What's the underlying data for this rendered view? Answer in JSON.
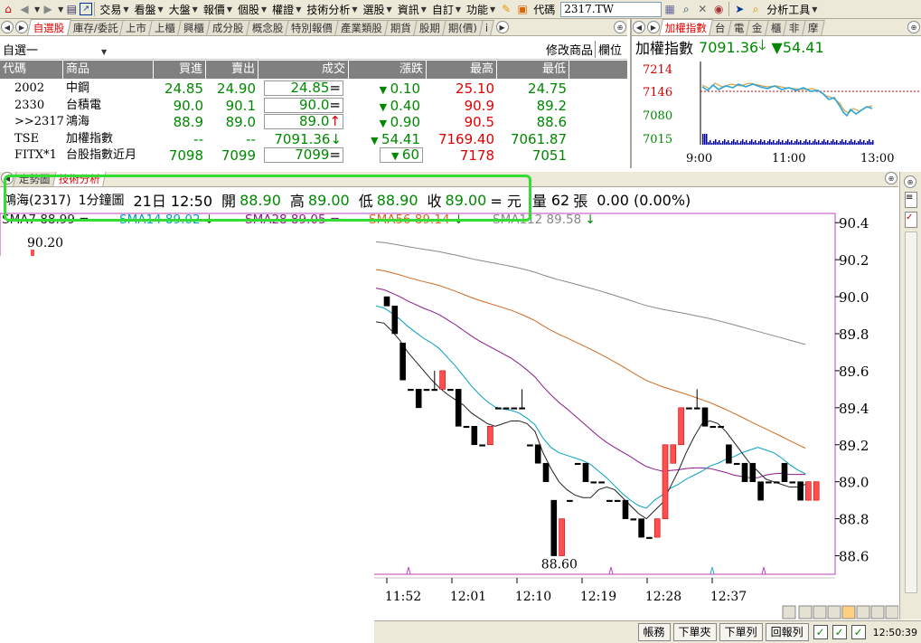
{
  "toolbar": {
    "items": [
      "交易",
      "看盤",
      "大盤",
      "報價",
      "個股",
      "權證",
      "技術分析",
      "選股",
      "資訊",
      "自訂",
      "功能"
    ],
    "code_label": "代碼",
    "code_value": "2317.TW",
    "analysis_tools": "分析工具"
  },
  "top_tabs": [
    "自選股",
    "庫存/委託",
    "上市",
    "上櫃",
    "興櫃",
    "成分股",
    "概念股",
    "特別報價",
    "產業類股",
    "期貨",
    "股期",
    "期(價)",
    "i"
  ],
  "watchlist": {
    "group_name": "自選一",
    "modify_label": "修改商品",
    "column_label": "欄位",
    "columns": [
      "代碼",
      "商品",
      "買進",
      "賣出",
      "成交",
      "漲跌",
      "最高",
      "最低"
    ],
    "rows": [
      {
        "code": "2002",
        "name": "中鋼",
        "bid": "24.85",
        "ask": "24.90",
        "last": "24.85",
        "flag": "=",
        "chg": "0.10",
        "high": "25.10",
        "low": "24.75"
      },
      {
        "code": "2330",
        "name": "台積電",
        "bid": "90.0",
        "ask": "90.1",
        "last": "90.0",
        "flag": "=",
        "chg": "0.40",
        "high": "90.9",
        "low": "89.2"
      },
      {
        "code": ">>2317",
        "name": "鴻海",
        "bid": "88.9",
        "ask": "89.0",
        "last": "89.0",
        "flag": "↑",
        "chg": "0.90",
        "high": "90.5",
        "low": "88.6"
      },
      {
        "code": "TSE",
        "name": "加權指數",
        "bid": "--",
        "ask": "--",
        "last": "7091.36",
        "flag": "↓",
        "chg": "54.41",
        "high": "7169.40",
        "low": "7061.87"
      },
      {
        "code": "FITX*1",
        "name": "台股指數近月",
        "bid": "7098",
        "ask": "7099",
        "last": "7099",
        "flag": "=",
        "chg": "60",
        "high": "7178",
        "low": "7051"
      }
    ]
  },
  "index_panel": {
    "tabs": [
      "加權指數",
      "台",
      "電",
      "金",
      "櫃",
      "非",
      "摩"
    ],
    "title": "加權指數",
    "value": "7091.36",
    "change": "54.41",
    "y_ticks": [
      "7214",
      "7146",
      "7080",
      "7015"
    ],
    "x_ticks": [
      "9:00",
      "11:00",
      "13:00"
    ]
  },
  "chart_tabs": [
    "走勢圖",
    "技術分析"
  ],
  "info": {
    "stock": "鴻海(2317)",
    "period": "1分鐘圖",
    "datetime": "21日 12:50",
    "open_label": "開",
    "open": "88.90",
    "high_label": "高",
    "high": "89.00",
    "low_label": "低",
    "low": "88.90",
    "close_label": "收",
    "close": "89.00",
    "unit": "= 元",
    "vol_label": "量",
    "vol": "62",
    "vol_unit": "張",
    "change": "0.00 (0.00%)"
  },
  "ma_labels": [
    {
      "text": "SMA7 88.99",
      "arrow": "=",
      "color": "#222222"
    },
    {
      "text": "SMA14 89.02",
      "arrow": "↓",
      "color": "#00a0c0"
    },
    {
      "text": "SMA28 89.05",
      "arrow": "=",
      "color": "#8b1a8b"
    },
    {
      "text": "SMA56 89.14",
      "arrow": "↓",
      "color": "#d2691e"
    },
    {
      "text": "SMA112 89.58",
      "arrow": "↓",
      "color": "#888888"
    }
  ],
  "chart_data": {
    "type": "candlestick",
    "y_ticks": [
      "90.4",
      "90.2",
      "90.0",
      "89.8",
      "89.6",
      "89.4",
      "89.2",
      "89.0",
      "88.8",
      "88.6"
    ],
    "ylim": [
      88.5,
      90.45
    ],
    "x_ticks": [
      "11:52",
      "12:01",
      "12:10",
      "12:19",
      "12:28",
      "12:37"
    ],
    "max_label": "90.20",
    "min_label": "88.60",
    "candles": [
      [
        90.0,
        90.0,
        89.95,
        89.95
      ],
      [
        89.95,
        89.95,
        89.8,
        89.8
      ],
      [
        89.75,
        89.75,
        89.55,
        89.55
      ],
      [
        89.5,
        89.5,
        89.5,
        89.5
      ],
      [
        89.5,
        89.5,
        89.4,
        89.4
      ],
      [
        89.5,
        89.5,
        89.5,
        89.5
      ],
      [
        89.5,
        89.6,
        89.5,
        89.5
      ],
      [
        89.5,
        89.6,
        89.5,
        89.6
      ],
      [
        89.5,
        89.5,
        89.5,
        89.5
      ],
      [
        89.5,
        89.5,
        89.3,
        89.3
      ],
      [
        89.3,
        89.3,
        89.3,
        89.3
      ],
      [
        89.3,
        89.3,
        89.2,
        89.2
      ],
      [
        89.2,
        89.2,
        89.2,
        89.2
      ],
      [
        89.2,
        89.3,
        89.2,
        89.3
      ],
      [
        89.4,
        89.4,
        89.4,
        89.4
      ],
      [
        89.4,
        89.4,
        89.4,
        89.4
      ],
      [
        89.4,
        89.4,
        89.4,
        89.4
      ],
      [
        89.4,
        89.5,
        89.4,
        89.4
      ],
      [
        89.2,
        89.2,
        89.2,
        89.2
      ],
      [
        89.2,
        89.2,
        89.1,
        89.1
      ],
      [
        89.1,
        89.1,
        89.0,
        89.0
      ],
      [
        88.9,
        88.9,
        88.6,
        88.6
      ],
      [
        88.6,
        88.8,
        88.6,
        88.8
      ],
      [
        88.9,
        88.9,
        88.9,
        88.9
      ],
      [
        89.1,
        89.1,
        89.1,
        89.1
      ],
      [
        89.1,
        89.1,
        89.0,
        89.0
      ],
      [
        89.0,
        89.0,
        89.0,
        89.0
      ],
      [
        89.0,
        89.0,
        89.0,
        89.0
      ],
      [
        88.9,
        88.9,
        88.9,
        88.9
      ],
      [
        88.9,
        88.9,
        88.9,
        88.9
      ],
      [
        88.9,
        88.9,
        88.8,
        88.8
      ],
      [
        88.8,
        88.8,
        88.8,
        88.8
      ],
      [
        88.8,
        88.8,
        88.7,
        88.7
      ],
      [
        88.7,
        88.7,
        88.7,
        88.7
      ],
      [
        88.7,
        88.8,
        88.7,
        88.8
      ],
      [
        88.8,
        89.2,
        88.8,
        89.2
      ],
      [
        89.1,
        89.2,
        89.1,
        89.2
      ],
      [
        89.2,
        89.4,
        89.2,
        89.4
      ],
      [
        89.4,
        89.4,
        89.4,
        89.4
      ],
      [
        89.4,
        89.5,
        89.4,
        89.4
      ],
      [
        89.4,
        89.4,
        89.3,
        89.3
      ],
      [
        89.3,
        89.3,
        89.3,
        89.3
      ],
      [
        89.3,
        89.3,
        89.3,
        89.3
      ],
      [
        89.2,
        89.2,
        89.1,
        89.1
      ],
      [
        89.1,
        89.1,
        89.1,
        89.1
      ],
      [
        89.1,
        89.1,
        89.0,
        89.0
      ],
      [
        89.1,
        89.1,
        89.0,
        89.0
      ],
      [
        89.0,
        89.0,
        88.9,
        88.9
      ],
      [
        89.0,
        89.0,
        89.0,
        89.0
      ],
      [
        89.0,
        89.0,
        89.0,
        89.0
      ],
      [
        89.1,
        89.1,
        89.0,
        89.0
      ],
      [
        89.0,
        89.0,
        89.0,
        89.0
      ],
      [
        89.0,
        89.0,
        88.9,
        88.9
      ],
      [
        88.9,
        89.0,
        88.9,
        89.0
      ],
      [
        88.9,
        89.0,
        88.9,
        89.0
      ]
    ]
  },
  "status": {
    "buttons": [
      "帳務",
      "下單夾",
      "下單列",
      "回報列"
    ],
    "clock": "12:50:39"
  }
}
